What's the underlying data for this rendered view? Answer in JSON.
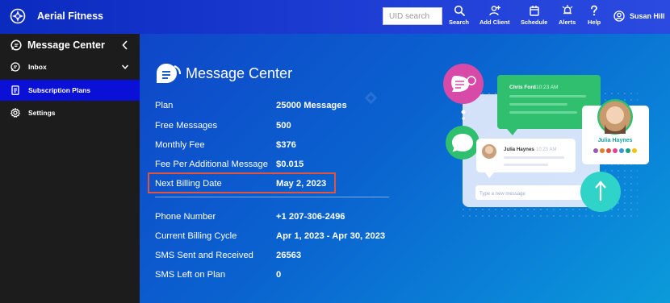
{
  "app": {
    "name": "Aerial Fitness"
  },
  "topbar": {
    "search_placeholder": "UID search",
    "tools": [
      {
        "label": "Search",
        "icon": "search-icon"
      },
      {
        "label": "Add Client",
        "icon": "add-user-icon"
      },
      {
        "label": "Schedule",
        "icon": "calendar-icon"
      },
      {
        "label": "Alerts",
        "icon": "bell-icon"
      },
      {
        "label": "Help",
        "icon": "help-icon"
      }
    ],
    "user_name": "Susan Hill"
  },
  "sidebar": {
    "title": "Message Center",
    "items": [
      {
        "label": "Inbox",
        "icon": "inbox-icon"
      },
      {
        "label": "Subscription Plans",
        "icon": "document-icon",
        "active": true
      },
      {
        "label": "Settings",
        "icon": "gear-icon"
      }
    ]
  },
  "main": {
    "title": "Message Center",
    "details": [
      {
        "label": "Plan",
        "value": "25000 Messages"
      },
      {
        "label": "Free Messages",
        "value": "500"
      },
      {
        "label": "Monthly Fee",
        "value": "$376"
      },
      {
        "label": "Fee Per Additional Message",
        "value": "$0.015"
      },
      {
        "label": "Next Billing Date",
        "value": "May 2, 2023"
      }
    ],
    "phone_details": [
      {
        "label": "Phone Number",
        "value": "+1 207-306-2496"
      },
      {
        "label": "Current Billing Cycle",
        "value": "Apr 1, 2023 - Apr 30, 2023"
      },
      {
        "label": "SMS Sent and Received",
        "value": "26563"
      },
      {
        "label": "SMS Left on Plan",
        "value": "0"
      }
    ]
  },
  "illustration": {
    "chat1_name": "Chris Ford",
    "chat1_time": "10:23 AM",
    "chat2_name": "Julia Haynes",
    "chat2_time": "10:23 AM",
    "input_placeholder": "Type a new message",
    "profile_name": "Julia Haynes"
  },
  "colors": {
    "topbar": "#1f3fd6",
    "sidebar": "#1c1c1c",
    "active_item": "#0a10d6",
    "highlight_border": "#e3543d",
    "green_bubble": "#2fbf6f",
    "pink_circle": "#d84aa8",
    "teal_circle": "#2fd3c8"
  }
}
